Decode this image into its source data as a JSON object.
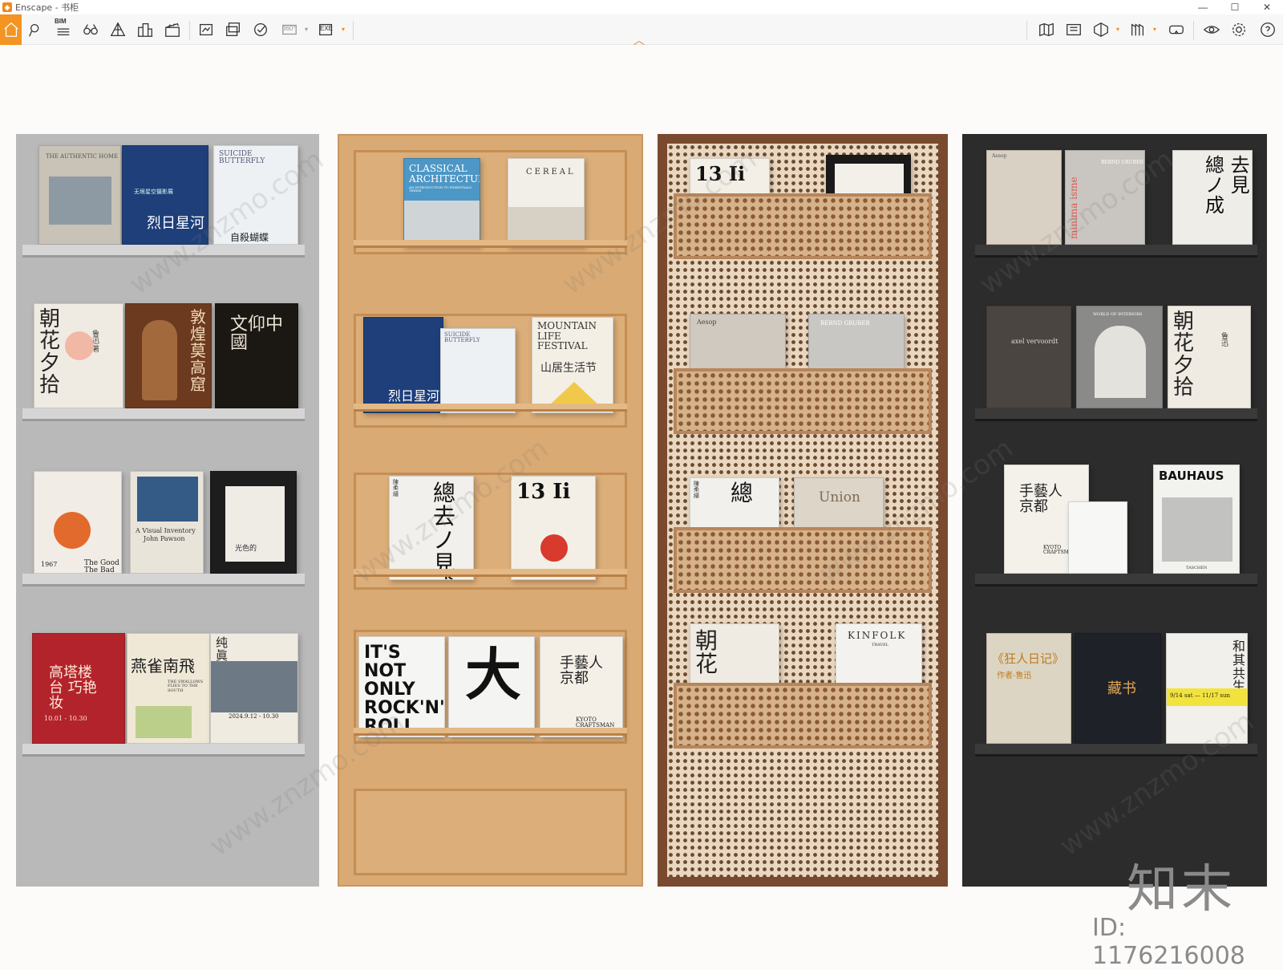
{
  "window": {
    "title": "Enscape - 书柜",
    "logo_icon": "enscape-logo-icon",
    "controls": [
      "minimize-icon",
      "maximize-icon",
      "close-icon"
    ]
  },
  "toolbar": {
    "accent_color": "#f39423",
    "left_tools": [
      "home-icon",
      "location-pin-icon",
      "bim-list-icon",
      "binoculars-icon",
      "perspective-icon",
      "buildings-icon",
      "clapper-icon",
      "screenshot-icon",
      "batch-render-icon",
      "web-export-icon",
      "panorama-360-icon",
      "exe-export-icon"
    ],
    "bim_label": "BIM",
    "pano_label": "360°",
    "exe_label": "EXE",
    "right_tools": [
      "map-view-icon",
      "asset-library-icon",
      "section-icon",
      "views-icon",
      "vr-headset-icon",
      "visibility-icon",
      "settings-icon",
      "help-icon"
    ]
  },
  "viewport": {
    "shelves": [
      {
        "name": "grey-shelf",
        "books": [
          {
            "title": "THE AUTHENTIC HOME",
            "sub": ""
          },
          {
            "title": "烈日星河",
            "sub": "无垠星空摄影展"
          },
          {
            "title": "SUICIDE BUTTERFLY",
            "sub": "自殺蝴蝶"
          },
          {
            "title": "朝 花 夕 拾",
            "sub": "鲁迅 著"
          },
          {
            "title": "敦煌莫高窟",
            "sub": ""
          },
          {
            "title": "文仰中國",
            "sub": ""
          },
          {
            "title": "The Good The Bad",
            "sub": "1967"
          },
          {
            "title": "A Visual Inventory",
            "sub": "John Pawson"
          },
          {
            "title": "光色的",
            "sub": ""
          },
          {
            "title": "高塔楼台 巧艳妆",
            "sub": "10.01 - 10.30"
          },
          {
            "title": "燕雀南飛",
            "sub": "THE SWALLOWS FLIES TO THE SOUTH"
          },
          {
            "title": "纯 眞 詩 心",
            "sub": "2024.9.12 - 10.30"
          }
        ]
      },
      {
        "name": "wood-shelf",
        "books": [
          {
            "title": "CLASSICAL ARCHITECTURE",
            "sub": "AN INTRODUCTION TO ESSENTIALS TERMS"
          },
          {
            "title": "CEREAL",
            "sub": ""
          },
          {
            "title": "烈日星河",
            "sub": ""
          },
          {
            "title": "SUICIDE BUTTERFLY",
            "sub": ""
          },
          {
            "title": "MOUNTAIN LIFE FESTIVAL",
            "sub": "山居生活节"
          },
          {
            "title": "總 去ノ 見 成",
            "sub": "陳 柔 縉"
          },
          {
            "title": "13 Ii",
            "sub": ""
          },
          {
            "title": "IT'S NOT ONLY ROCK'N' ROLL BABY!",
            "sub": ""
          },
          {
            "title": "大",
            "sub": ""
          },
          {
            "title": "手藝人 京都",
            "sub": "KYOTO CRAFTSMAN"
          }
        ]
      },
      {
        "name": "rattan-shelf",
        "books": [
          {
            "title": "13 Ii",
            "sub": ""
          },
          {
            "title": "Aesop",
            "sub": ""
          },
          {
            "title": "BERND GRUBER",
            "sub": ""
          },
          {
            "title": "總",
            "sub": "陳柔縉"
          },
          {
            "title": "Union",
            "sub": ""
          },
          {
            "title": "朝 花",
            "sub": ""
          },
          {
            "title": "KINFOLK",
            "sub": "TRAVEL"
          }
        ]
      },
      {
        "name": "dark-shelf",
        "books": [
          {
            "title": "Aesop",
            "sub": ""
          },
          {
            "title": "minima isme",
            "sub": "BERND GRUBER"
          },
          {
            "title": "總 去ノ 見 成",
            "sub": ""
          },
          {
            "title": "axel vervoordt",
            "sub": ""
          },
          {
            "title": "WORLD OF INTERIORS",
            "sub": ""
          },
          {
            "title": "朝 花 夕 拾",
            "sub": "鲁迅"
          },
          {
            "title": "手藝人 京都",
            "sub": "KYOTO CRAFTSMAN"
          },
          {
            "title": "BAUHAUS",
            "sub": "TASCHEN"
          },
          {
            "title": "《狂人日记》",
            "sub": "作者-鲁迅"
          },
          {
            "title": "藏书",
            "sub": ""
          },
          {
            "title": "和 其 共 生",
            "sub": "9/14 sat — 11/17 sun"
          }
        ]
      }
    ],
    "watermark_text": "www.znzmo.com",
    "brand_mark": "知末",
    "id_label": "ID: 1176216008"
  }
}
